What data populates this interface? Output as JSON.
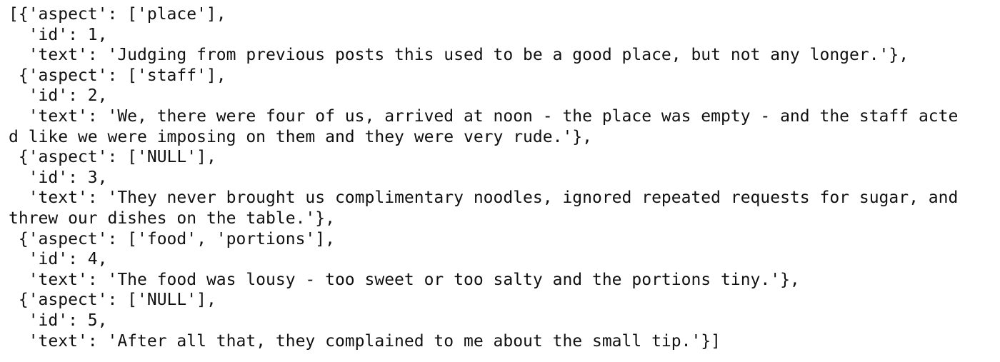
{
  "output": {
    "lines": [
      "[{'aspect': ['place'],",
      "  'id': 1,",
      "  'text': 'Judging from previous posts this used to be a good place, but not any longer.'},",
      " {'aspect': ['staff'],",
      "  'id': 2,",
      "  'text': 'We, there were four of us, arrived at noon - the place was empty - and the staff acte",
      "d like we were imposing on them and they were very rude.'},",
      " {'aspect': ['NULL'],",
      "  'id': 3,",
      "  'text': 'They never brought us complimentary noodles, ignored repeated requests for sugar, and",
      "threw our dishes on the table.'},",
      " {'aspect': ['food', 'portions'],",
      "  'id': 4,",
      "  'text': 'The food was lousy - too sweet or too salty and the portions tiny.'},",
      " {'aspect': ['NULL'],",
      "  'id': 5,",
      "  'text': 'After all that, they complained to me about the small tip.'}]"
    ]
  }
}
